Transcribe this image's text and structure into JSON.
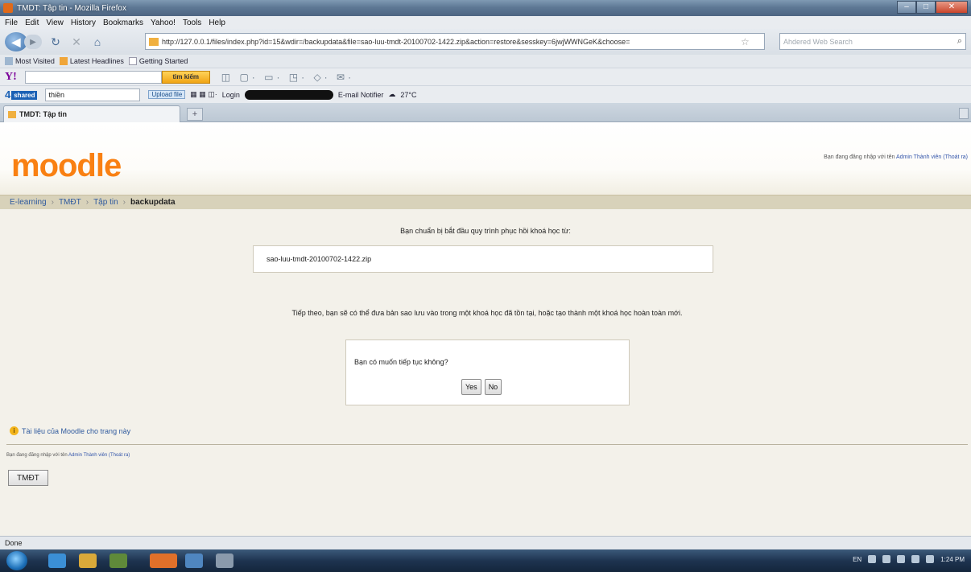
{
  "window": {
    "title": "TMDT: Tập tin - Mozilla Firefox"
  },
  "menu": [
    "File",
    "Edit",
    "View",
    "History",
    "Bookmarks",
    "Yahoo!",
    "Tools",
    "Help"
  ],
  "navbar": {
    "url": "http://127.0.0.1/files/index.php?id=15&wdir=/backupdata&file=sao-luu-tmdt-20100702-1422.zip&action=restore&sesskey=6jwjWWNGeK&choose=",
    "search_placeholder": "Ahdered Web Search"
  },
  "bookmarks": [
    "Most Visited",
    "Latest Headlines",
    "Getting Started"
  ],
  "yahoo_toolbar": {
    "search_button": "tìm kiếm"
  },
  "shared_toolbar": {
    "logo": "4",
    "logo_box": "shared",
    "input_value": "thiền",
    "upload_label": "Upload file",
    "login_label": "Login",
    "email_label": "E-mail Notifier",
    "temperature": "27°C"
  },
  "tab": {
    "title": "TMDT: Tập tin"
  },
  "moodle": {
    "logo": "moodle",
    "login_prefix": "Bạn đang đăng nhập với tên",
    "user_name": "Admin Thành viên",
    "logout": "(Thoát ra)",
    "breadcrumb": [
      "E-learning",
      "TMĐT",
      "Tập tin",
      "backupdata"
    ],
    "intro": "Bạn chuẩn bị bắt đầu quy trình phục hồi khoá học từ:",
    "filename": "sao-luu-tmdt-20100702-1422.zip",
    "next_msg": "Tiếp theo, bạn sẽ có thể đưa bản sao lưu vào trong một khoá học đã tồn tại, hoặc tạo thành một khoá học hoàn toàn mới.",
    "confirm_question": "Bạn có muốn tiếp tục không?",
    "yes_label": "Yes",
    "no_label": "No",
    "docs_link": "Tài liệu của Moodle cho trang này",
    "footer_login_prefix": "Bạn đang đăng nhập với tên",
    "footer_user": "Admin Thành viên",
    "footer_logout": "(Thoát ra)",
    "course_button": "TMĐT"
  },
  "status": "Done",
  "taskbar": {
    "lang": "EN",
    "time": "1:24 PM"
  }
}
